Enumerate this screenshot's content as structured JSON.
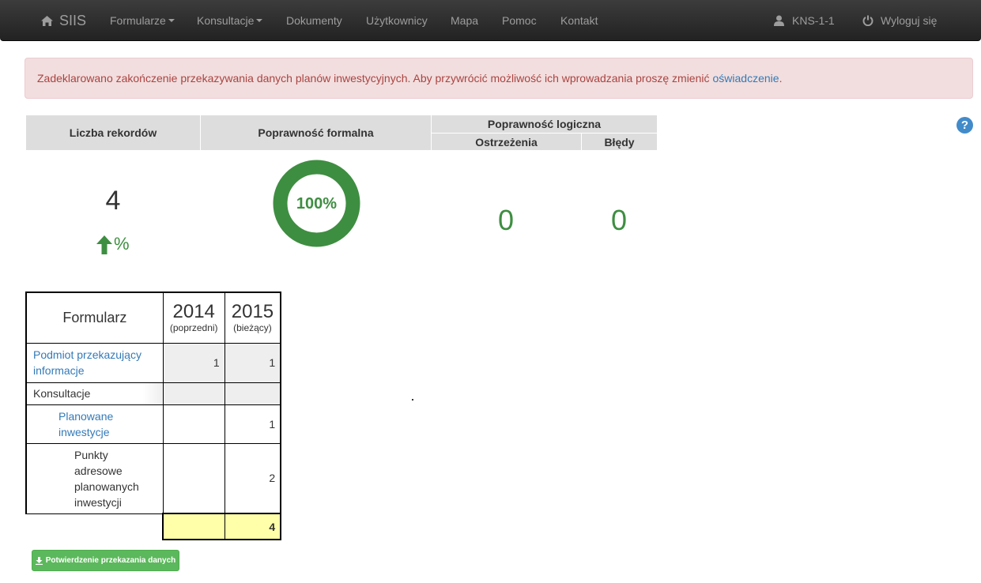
{
  "nav": {
    "brand": "SIIS",
    "items": [
      {
        "label": "Formularze",
        "dropdown": true
      },
      {
        "label": "Konsultacje",
        "dropdown": true
      },
      {
        "label": "Dokumenty"
      },
      {
        "label": "Użytkownicy"
      },
      {
        "label": "Mapa"
      },
      {
        "label": "Pomoc"
      },
      {
        "label": "Kontakt"
      }
    ],
    "user": "KNS-1-1",
    "logout": "Wyloguj się"
  },
  "alert": {
    "text": "Zadeklarowano zakończenie przekazywania danych planów inwestycyjnych. Aby przywrócić możliwość ich wprowadzania proszę zmienić",
    "link": "oświadczenie",
    "end": "."
  },
  "stats": {
    "records_header": "Liczba rekordów",
    "formal_header": "Poprawność formalna",
    "logical_header": "Poprawność logiczna",
    "warnings_header": "Ostrzeżenia",
    "errors_header": "Błędy",
    "records_value": "4",
    "trend_symbol": "%",
    "formal_percent": 100,
    "formal_label": "100%",
    "warnings_value": "0",
    "errors_value": "0",
    "help": "?"
  },
  "form_table": {
    "header": "Formularz",
    "year_prev": "2014",
    "year_prev_label": "(poprzedni)",
    "year_curr": "2015",
    "year_curr_label": "(bieżący)",
    "rows": [
      {
        "name": "Podmiot przekazujący informacje",
        "prev": "1",
        "curr": "1"
      },
      {
        "name": "Konsultacje",
        "prev": "",
        "curr": ""
      },
      {
        "name": "Planowane inwestycje",
        "prev": "",
        "curr": "1"
      },
      {
        "name": "Punkty adresowe planowanych inwestycji",
        "prev": "",
        "curr": "2"
      }
    ],
    "total_prev": "",
    "total_curr": "4"
  },
  "confirm_button": "Potwierdzenie przekazania danych",
  "colors": {
    "accent_green": "#3e8e41",
    "link_blue": "#337ab7",
    "alert_red": "#a94442"
  }
}
